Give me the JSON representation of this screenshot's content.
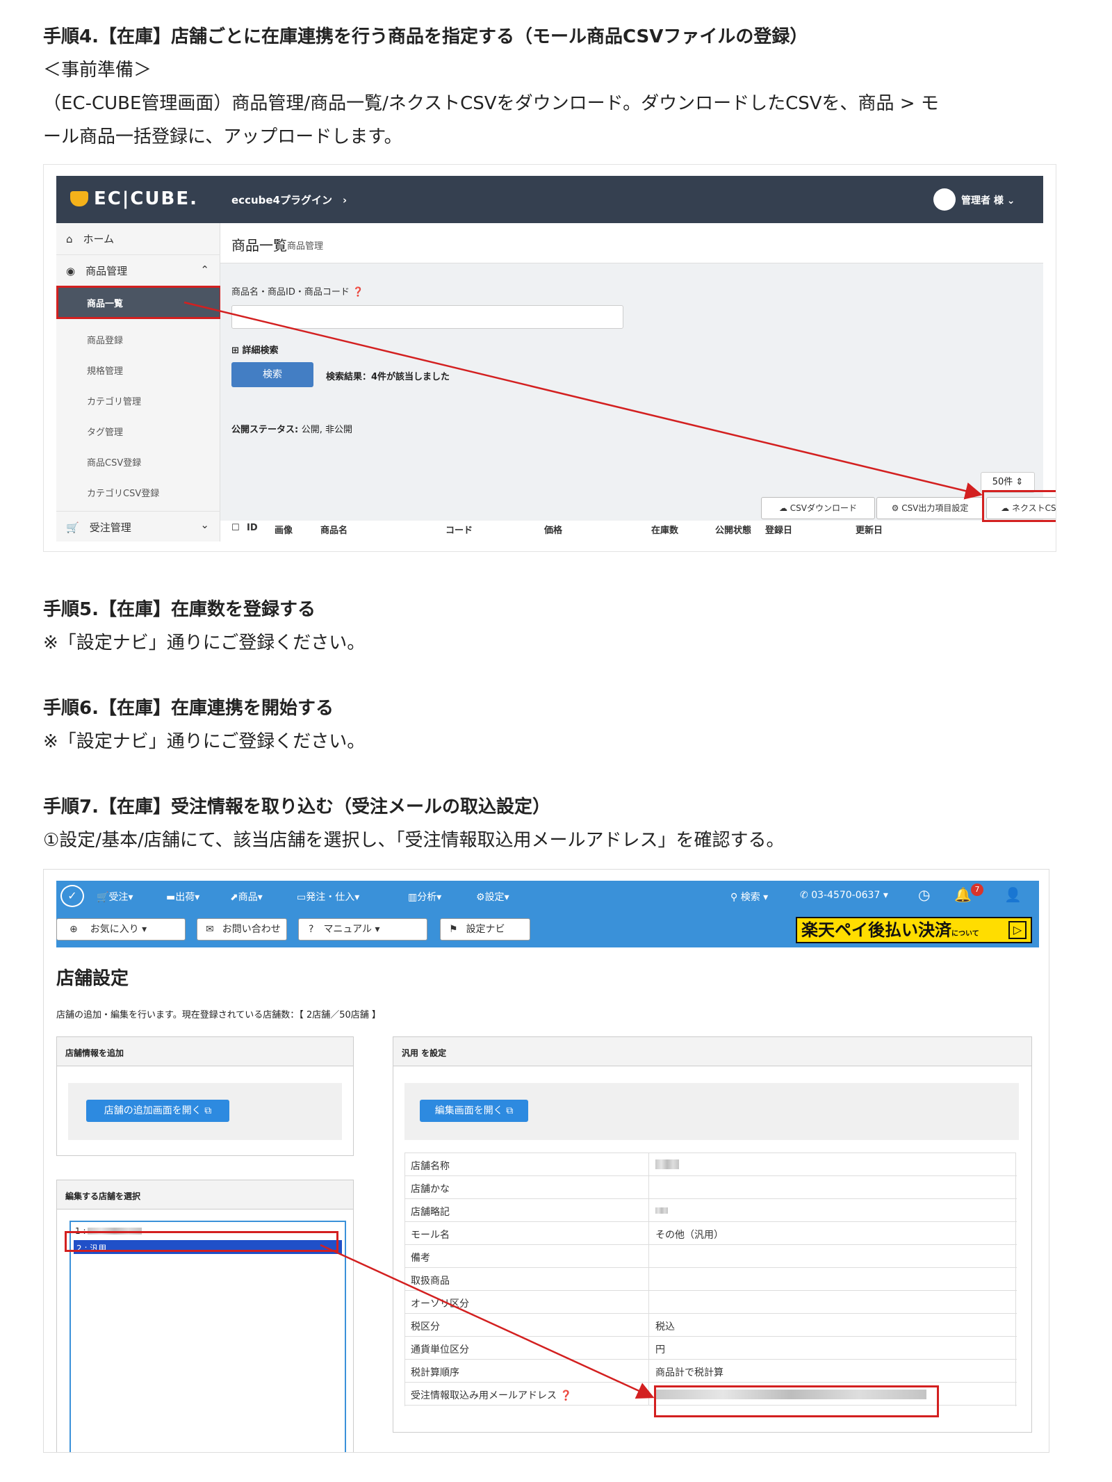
{
  "step4": {
    "heading": "手順4.【在庫】店舗ごとに在庫連携を行う商品を指定する（モール商品CSVファイルの登録）",
    "prep": "＜事前準備＞",
    "body1": "（EC-CUBE管理画面）商品管理/商品一覧/ネクストCSVをダウンロード。ダウンロードしたCSVを、商品 > モ",
    "body2": "ール商品一括登録に、アップロードします。"
  },
  "eccube": {
    "logo": "EC|CUBE.",
    "plugin": "eccube4プラグイン",
    "user": "管理者 様",
    "sidebar": [
      {
        "label": "ホーム",
        "icon": "home-icon"
      },
      {
        "label": "商品管理",
        "icon": "cube-icon"
      },
      {
        "label": "商品一覧"
      },
      {
        "label": "商品登録"
      },
      {
        "label": "規格管理"
      },
      {
        "label": "カテゴリ管理"
      },
      {
        "label": "タグ管理"
      },
      {
        "label": "商品CSV登録"
      },
      {
        "label": "カテゴリCSV登録"
      },
      {
        "label": "受注管理",
        "icon": "cart-icon"
      }
    ],
    "page_title": "商品一覧",
    "page_sub": "商品管理",
    "search_label": "商品名・商品ID・商品コード",
    "detail_search": "詳細検索",
    "search_btn": "検索",
    "result": "検索結果：4件が該当しました",
    "status": "公開ステータス:",
    "status_value": "公開, 非公開",
    "per_page": "50件",
    "btn_csv_dl": "CSVダウンロード",
    "btn_csv_cfg": "CSV出力項目設定",
    "btn_next_csv": "ネクストCSV",
    "columns": [
      "ID",
      "画像",
      "商品名",
      "コード",
      "価格",
      "在庫数",
      "公開状態",
      "登録日",
      "更新日"
    ]
  },
  "step5": {
    "heading": "手順5.【在庫】在庫数を登録する",
    "note": "※「設定ナビ」通りにご登録ください。"
  },
  "step6": {
    "heading": "手順6.【在庫】在庫連携を開始する",
    "note": "※「設定ナビ」通りにご登録ください。"
  },
  "step7": {
    "heading": "手順7.【在庫】受注情報を取り込む（受注メールの取込設定）",
    "body": "①設定/基本/店舗にて、該当店舗を選択し、「受注情報取込用メールアドレス」を確認する。"
  },
  "next": {
    "nav": [
      "受注",
      "出荷",
      "商品",
      "発注・仕入",
      "分析",
      "設定"
    ],
    "search": "検索",
    "phone": "03-4570-0637",
    "badge": "7",
    "toolbar": [
      "お気に入り",
      "お問い合わせ",
      "マニュアル",
      "設定ナビ"
    ],
    "banner": "楽天ペイ後払い決済",
    "banner_small": "について",
    "title": "店舗設定",
    "desc": "店舗の追加・編集を行います。現在登録されている店舗数：【 2店舗／50店舗 】",
    "panel_add": "店舗情報を追加",
    "btn_add": "店舗の追加画面を開く",
    "panel_select": "編集する店舗を選択",
    "shops": [
      "1 :",
      "2 : 汎用"
    ],
    "panel_edit": "汎用 を設定",
    "btn_edit": "編集画面を開く",
    "table": [
      {
        "label": "店舗名称",
        "value": ""
      },
      {
        "label": "店舗かな",
        "value": ""
      },
      {
        "label": "店舗略記",
        "value": ""
      },
      {
        "label": "モール名",
        "value": "その他（汎用）"
      },
      {
        "label": "備考",
        "value": ""
      },
      {
        "label": "取扱商品",
        "value": ""
      },
      {
        "label": "オーソリ区分",
        "value": ""
      },
      {
        "label": "税区分",
        "value": "税込"
      },
      {
        "label": "通貨単位区分",
        "value": "円"
      },
      {
        "label": "税計算順序",
        "value": "商品計で税計算"
      },
      {
        "label": "受注情報取込み用メールアドレス",
        "value": ""
      }
    ]
  }
}
